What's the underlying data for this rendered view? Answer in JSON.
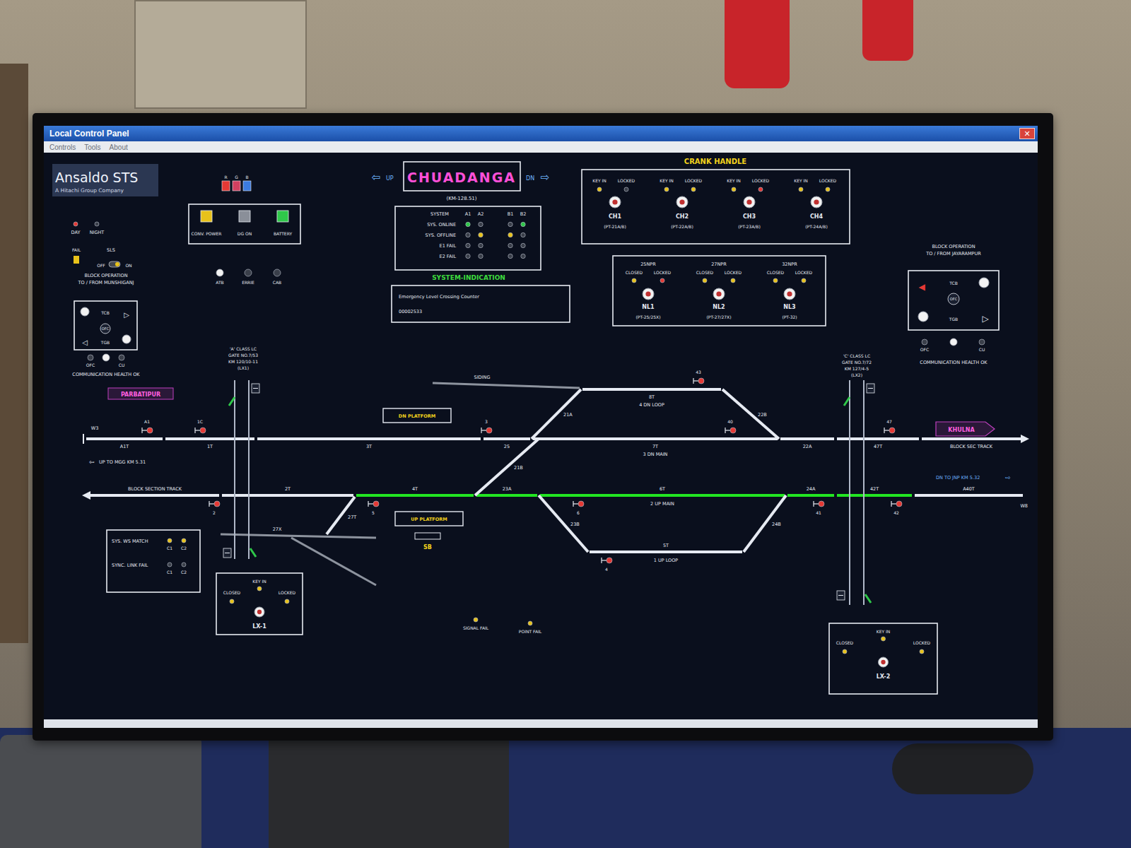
{
  "window": {
    "title": "Local Control Panel",
    "close": "✕"
  },
  "menu": [
    {
      "label": "Controls"
    },
    {
      "label": "Tools"
    },
    {
      "label": "About"
    }
  ],
  "logo": {
    "name": "Ansaldo STS",
    "tagline": "A Hitachi Group Company"
  },
  "rgb": [
    {
      "label": "R",
      "color": "#e53935"
    },
    {
      "label": "G",
      "color": "#d04060"
    },
    {
      "label": "B",
      "color": "#3b7be0"
    }
  ],
  "day_night": [
    {
      "label": "DAY",
      "on": true
    },
    {
      "label": "NIGHT",
      "on": false
    }
  ],
  "power": [
    {
      "label": "CONV. POWER",
      "color": "#e8c21a"
    },
    {
      "label": "DG ON",
      "color": "#8a8f99"
    },
    {
      "label": "BATTERY",
      "color": "#2fc84a"
    }
  ],
  "station": {
    "name": "CHUADANGA",
    "km": "(KM-128.51)",
    "up": "UP",
    "down": "DN",
    "up_arrow": "⇦",
    "down_arrow": "⇨"
  },
  "system": {
    "columns": [
      "SYSTEM",
      "A1",
      "A2",
      "B1",
      "B2"
    ],
    "rows": [
      {
        "label": "SYS. ONLINE",
        "lamps": [
          "#2fc84a",
          "#3a3f4a",
          "#3a3f4a",
          "#2fc84a"
        ]
      },
      {
        "label": "SYS. OFFLINE",
        "lamps": [
          "#3a3f4a",
          "#e8c21a",
          "#e8c21a",
          "#3a3f4a"
        ]
      },
      {
        "label": "E1 FAIL",
        "lamps": [
          "#3a3f4a",
          "#3a3f4a",
          "#3a3f4a",
          "#3a3f4a"
        ]
      },
      {
        "label": "E2 FAIL",
        "lamps": [
          "#3a3f4a",
          "#3a3f4a",
          "#3a3f4a",
          "#3a3f4a"
        ]
      }
    ]
  },
  "system_indication": {
    "title": "SYSTEM-INDICATION",
    "counter_label": "Emergency Level Crossing Counter",
    "counter": "00002533"
  },
  "crank_handle": {
    "title": "CRANK HANDLE",
    "items": [
      {
        "name": "CH1",
        "points": "(PT-21A/B)",
        "key_in": "KEY IN",
        "locked": "LOCKED",
        "key_in_color": "#e8c21a",
        "locked_color": "#3a3f4a"
      },
      {
        "name": "CH2",
        "points": "(PT-22A/B)",
        "key_in": "KEY IN",
        "locked": "LOCKED",
        "key_in_color": "#e8c21a",
        "locked_color": "#e8c21a"
      },
      {
        "name": "CH3",
        "points": "(PT-23A/B)",
        "key_in": "KEY IN",
        "locked": "LOCKED",
        "key_in_color": "#e8c21a",
        "locked_color": "#e53935"
      },
      {
        "name": "CH4",
        "points": "(PT-24A/B)",
        "key_in": "KEY IN",
        "locked": "LOCKED",
        "key_in_color": "#e8c21a",
        "locked_color": "#e8c21a"
      }
    ]
  },
  "npr": [
    {
      "title": "25NPR",
      "name": "NL1",
      "points": "(PT-25/25X)",
      "closed": "CLOSED",
      "locked": "LOCKED",
      "closed_color": "#e8c21a",
      "locked_color": "#e53935"
    },
    {
      "title": "27NPR",
      "name": "NL2",
      "points": "(PT-27/27X)",
      "closed": "CLOSED",
      "locked": "LOCKED",
      "closed_color": "#e8c21a",
      "locked_color": "#e8c21a"
    },
    {
      "title": "32NPR",
      "name": "NL3",
      "points": "(PT-32)",
      "closed": "CLOSED",
      "locked": "LOCKED",
      "closed_color": "#e8c21a",
      "locked_color": "#e8c21a"
    }
  ],
  "sls": {
    "fail": "FAIL",
    "label": "SLS",
    "off": "OFF",
    "on": "ON",
    "is_on": true
  },
  "aux": [
    {
      "label": "ATB",
      "color": "#f2f2f2"
    },
    {
      "label": "ERRIE",
      "color": "#3a3f4a"
    },
    {
      "label": "CAB",
      "color": "#3a3f4a"
    }
  ],
  "blocks": [
    {
      "title": "BLOCK OPERATION",
      "subtitle": "TO / FROM MUNSHIGANJ",
      "tcb": "TCB",
      "tgb": "TGB",
      "center": "OFC",
      "arrow_out": "▷",
      "arrow_in": "◁",
      "arrow_out_lit": false,
      "arrow_in_lit": false,
      "lamp_a": "#f2f2f2",
      "lamp_b": "#f2f2f2",
      "lamps": [
        {
          "label": "OFC",
          "color": "#3a3f4a"
        },
        {
          "color": "#f2f2f2"
        },
        {
          "label": "CU",
          "color": "#3a3f4a"
        }
      ],
      "health": "COMMUNICATION HEALTH OK"
    },
    {
      "title": "BLOCK OPERATION",
      "subtitle": "TO / FROM JAYARAMPUR",
      "tcb": "TCB",
      "tgb": "TGB",
      "center": "OFC",
      "arrow_out": "▷",
      "arrow_in": "◀",
      "arrow_out_lit": false,
      "arrow_in_lit": true,
      "lamp_a": "#f2f2f2",
      "lamp_b": "#f2f2f2",
      "lamps": [
        {
          "label": "OFC",
          "color": "#3a3f4a"
        },
        {
          "color": "#f2f2f2"
        },
        {
          "label": "CU",
          "color": "#3a3f4a"
        }
      ],
      "health": "COMMUNICATION HEALTH OK"
    }
  ],
  "ends": {
    "west": "PARBATIPUR",
    "east": "KHULNA"
  },
  "platforms": {
    "dn": "DN PLATFORM",
    "up": "UP PLATFORM",
    "sb": "SB"
  },
  "directions": [
    {
      "arrow": "⇦",
      "label": "UP TO MGG KM 5.31"
    },
    {
      "arrow": "⇨",
      "label": "DN TO JNP KM 5.32"
    }
  ],
  "markers": [
    {
      "label": "W3"
    },
    {
      "label": "W8"
    }
  ],
  "sections": [
    {
      "label": "A1T",
      "kind": "track",
      "route": false
    },
    {
      "label": "1T",
      "kind": "track",
      "route": false
    },
    {
      "label": "3T",
      "kind": "track",
      "route": false
    },
    {
      "label": "25",
      "kind": "track",
      "route": false
    },
    {
      "label": "7T",
      "name": "3 DN MAIN",
      "kind": "track",
      "route": false
    },
    {
      "label": "22A",
      "kind": "track",
      "route": false
    },
    {
      "label": "47T",
      "kind": "track",
      "route": false
    },
    {
      "label": "BLOCK SEC TRACK",
      "kind": "track",
      "route": false
    },
    {
      "label": "BLOCK SECTION TRACK",
      "kind": "track",
      "route": false
    },
    {
      "label": "2T",
      "kind": "track",
      "route": false
    },
    {
      "label": "4T",
      "kind": "track",
      "route": true
    },
    {
      "label": "23A",
      "kind": "track",
      "route": true
    },
    {
      "label": "6T",
      "name": "2 UP MAIN",
      "kind": "track",
      "route": true
    },
    {
      "label": "24A",
      "kind": "track",
      "route": true
    },
    {
      "label": "42T",
      "kind": "track",
      "route": true
    },
    {
      "label": "A40T",
      "kind": "track",
      "route": false
    },
    {
      "label": "8T",
      "name": "4 DN LOOP",
      "kind": "track",
      "route": false
    },
    {
      "label": "5T",
      "name": "1 UP LOOP",
      "kind": "track",
      "route": false
    },
    {
      "label": "21A",
      "kind": "track",
      "route": false
    },
    {
      "label": "22B",
      "kind": "track",
      "route": false
    },
    {
      "label": "23B",
      "kind": "track",
      "route": false
    },
    {
      "label": "24B",
      "kind": "track",
      "route": false
    },
    {
      "label": "21B",
      "kind": "track",
      "route": false
    },
    {
      "label": "SIDING",
      "kind": "siding",
      "route": false
    },
    {
      "label": "27T",
      "kind": "track",
      "route": false
    },
    {
      "label": "27X",
      "kind": "siding",
      "route": false
    },
    {
      "kind": "siding",
      "route": false
    }
  ],
  "signals": [
    {
      "label": "A1",
      "color": "#e53935"
    },
    {
      "label": "1C",
      "color": "#e53935"
    },
    {
      "label": "3",
      "color": "#e53935"
    },
    {
      "label": "40",
      "color": "#e53935"
    },
    {
      "label": "47",
      "color": "#e53935"
    },
    {
      "label": "43",
      "color": "#e53935"
    },
    {
      "label": "2",
      "color": "#e53935"
    },
    {
      "label": "5",
      "color": "#e53935"
    },
    {
      "label": "6",
      "color": "#e53935"
    },
    {
      "label": "41",
      "color": "#e53935"
    },
    {
      "label": "42",
      "color": "#e53935"
    },
    {
      "label": "4",
      "color": "#e53935"
    }
  ],
  "lx": [
    {
      "title_lines": [
        "'A' CLASS LC",
        "GATE NO.7/53",
        "KM 120/10-11",
        "(LX1)"
      ],
      "barrier_color": "#2fc84a",
      "key_in": "KEY IN",
      "closed": "CLOSED",
      "locked": "LOCKED",
      "name": "LX-1",
      "key_in_color": "#e8c21a",
      "closed_color": "#e8c21a",
      "locked_color": "#e8c21a"
    },
    {
      "title_lines": [
        "'C' CLASS LC",
        "GATE NO.7/72",
        "KM 127/4-5",
        "(LX2)"
      ],
      "barrier_color": "#2fc84a",
      "key_in": "KEY IN",
      "closed": "CLOSED",
      "locked": "LOCKED",
      "name": "LX-2",
      "key_in_color": "#e8c21a",
      "closed_color": "#e8c21a",
      "locked_color": "#e8c21a"
    }
  ],
  "sys_box": [
    {
      "label": "SYS. WS MATCH",
      "lamps": [
        {
          "label": "C1",
          "color": "#e8c21a"
        },
        {
          "label": "C2",
          "color": "#e8c21a"
        }
      ]
    },
    {
      "label": "SYNC. LINK FAIL",
      "lamps": [
        {
          "label": "C1",
          "color": "#3a3f4a"
        },
        {
          "label": "C2",
          "color": "#3a3f4a"
        }
      ]
    }
  ],
  "fails": [
    {
      "label": "SIGNAL FAIL",
      "color": "#e8c21a"
    },
    {
      "label": "POINT FAIL",
      "color": "#e8c21a"
    }
  ]
}
